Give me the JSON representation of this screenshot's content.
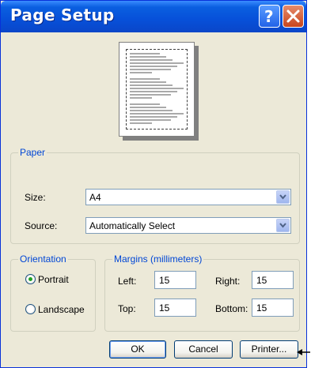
{
  "window": {
    "title": "Page Setup"
  },
  "titlebar_buttons": {
    "help": "help-icon",
    "close": "close-icon"
  },
  "paper": {
    "legend": "Paper",
    "size_label": "Size:",
    "size_value": "A4",
    "source_label": "Source:",
    "source_value": "Automatically Select"
  },
  "orientation": {
    "legend": "Orientation",
    "options": [
      {
        "label": "Portrait",
        "selected": true
      },
      {
        "label": "Landscape",
        "selected": false
      }
    ]
  },
  "margins": {
    "legend": "Margins (millimeters)",
    "left_label": "Left:",
    "left_value": "15",
    "right_label": "Right:",
    "right_value": "15",
    "top_label": "Top:",
    "top_value": "15",
    "bottom_label": "Bottom:",
    "bottom_value": "15"
  },
  "buttons": {
    "ok": "OK",
    "cancel": "Cancel",
    "printer": "Printer..."
  },
  "colors": {
    "titlebar": "#0a5fe0",
    "dialog_bg": "#ece9d8",
    "legend_text": "#0046d5",
    "radio_dot": "#21a121"
  }
}
